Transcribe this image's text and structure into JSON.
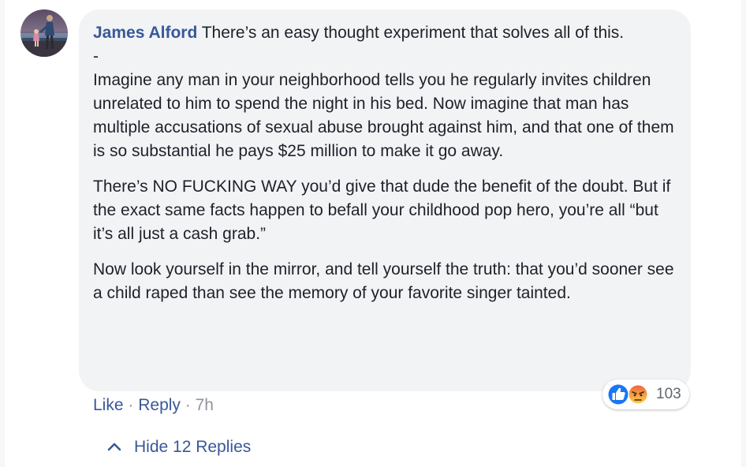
{
  "comment": {
    "author": "James Alford",
    "paragraphs": [
      "There’s an easy thought experiment that solves all of this.",
      "-",
      "Imagine any man in your neighborhood tells you he regularly invites children unrelated to him to spend the night in his bed. Now imagine that man has multiple accusations of sexual abuse brought against him, and that one of them is so substantial he pays $25 million to make it go away.",
      "There’s NO FUCKING WAY you’d give that dude the benefit of the doubt. But if the exact same facts happen to befall your childhood pop hero, you’re all “but it’s all just a cash grab.”",
      "Now look yourself in the mirror, and tell yourself the truth: that you’d sooner see a child raped than see the memory of your favorite singer tainted."
    ]
  },
  "actions": {
    "like": "Like",
    "separator": "·",
    "reply": "Reply",
    "timestamp": "7h"
  },
  "reactions": {
    "icons": [
      "like-icon",
      "angry-icon"
    ],
    "count": "103"
  },
  "replies": {
    "toggle_label": "Hide 12 Replies",
    "icon": "chevron-up-icon"
  },
  "colors": {
    "link": "#385898",
    "bubble": "#f2f3f5",
    "text": "#1d2129",
    "muted": "#90949c",
    "like_blue": "#1877f2",
    "angry_orange": "#f57731"
  }
}
